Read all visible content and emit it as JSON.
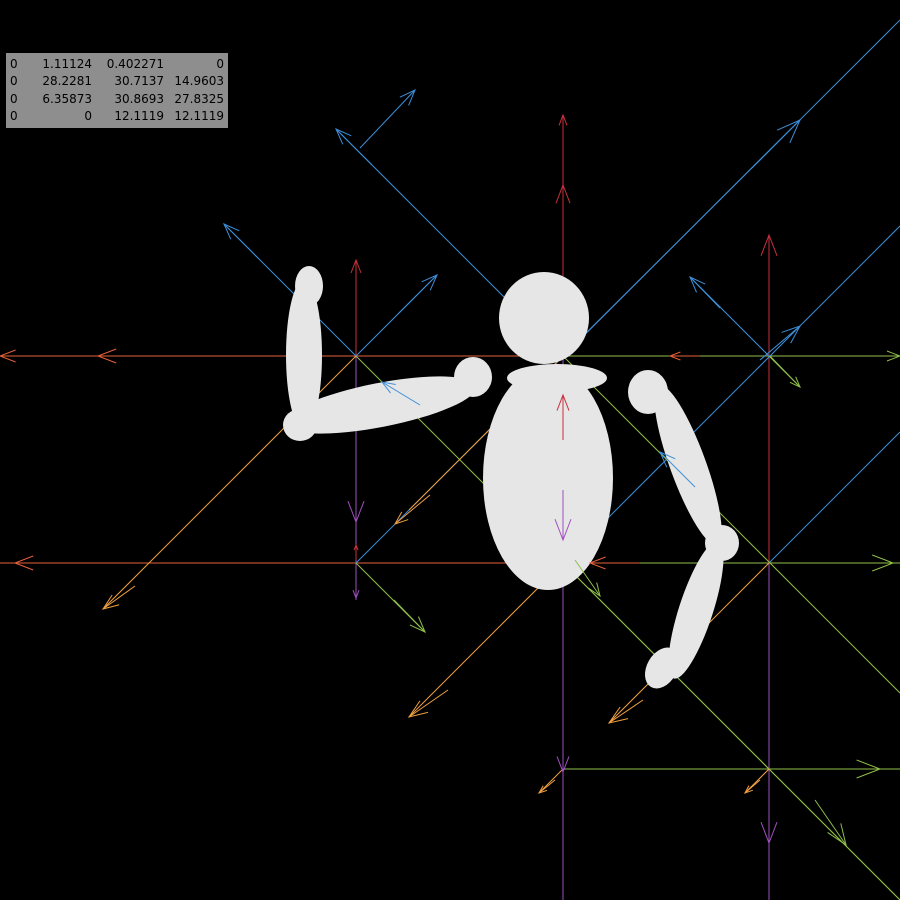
{
  "matrix_readout": {
    "rows": [
      [
        "0",
        "1.11124",
        "0.402271",
        "0"
      ],
      [
        "0",
        "28.2281",
        "30.7137",
        "14.9603"
      ],
      [
        "0",
        "6.35873",
        "30.8693",
        "27.8325"
      ],
      [
        "0",
        "0",
        "12.1119",
        "12.1119"
      ]
    ]
  },
  "colors": {
    "background": "#000000",
    "figure": "#e6e6e6",
    "panel": "#8e8e8e",
    "axis_red": "#c8303c",
    "axis_orange_red": "#e5603a",
    "axis_green": "#8fbf4a",
    "axis_blue": "#3d8fd8",
    "axis_orange": "#f0a040",
    "axis_purple": "#a050c0"
  },
  "scene": {
    "type": "3d-viewport",
    "object": "articulated-mannequin",
    "overlays": [
      "grid-lattice-arrows",
      "transform-matrix-readout"
    ]
  }
}
